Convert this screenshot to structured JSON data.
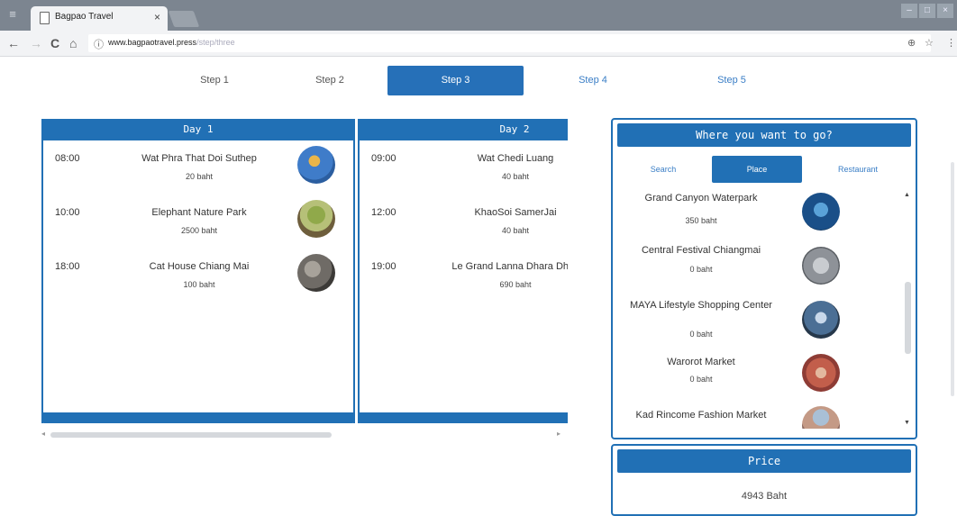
{
  "browser": {
    "tab_title": "Bagpao Travel",
    "tab_close": "×",
    "url_domain": "www.bagpaotravel.press",
    "url_path": "/step/three",
    "info_icon": "info-icon",
    "nav_back": "←",
    "nav_forward": "→",
    "nav_reload": "C",
    "nav_home": "⌂",
    "zoom_icon": "⊕",
    "star_icon": "☆",
    "menu_icon": "⋮"
  },
  "steps": [
    {
      "label": "Step 1"
    },
    {
      "label": "Step 2"
    },
    {
      "label": "Step 3"
    },
    {
      "label": "Step 4"
    },
    {
      "label": "Step 5"
    }
  ],
  "days": [
    {
      "title": "Day 1",
      "entries": [
        {
          "time": "08:00",
          "name": "Wat Phra That Doi Suthep",
          "price": "20 baht"
        },
        {
          "time": "10:00",
          "name": "Elephant Nature Park",
          "price": "2500 baht"
        },
        {
          "time": "18:00",
          "name": "Cat House Chiang Mai",
          "price": "100 baht"
        }
      ]
    },
    {
      "title": "Day 2",
      "entries": [
        {
          "time": "09:00",
          "name": "Wat Chedi Luang",
          "price": "40 baht"
        },
        {
          "time": "12:00",
          "name": "KhaoSoi SamerJai",
          "price": "40 baht"
        },
        {
          "time": "19:00",
          "name": "Le Grand Lanna Dhara Dhev",
          "price": "690 baht"
        }
      ]
    }
  ],
  "where": {
    "title": "Where you want to go?",
    "tabs": [
      "Search",
      "Place",
      "Restaurant"
    ],
    "places": [
      {
        "name": "Grand Canyon Waterpark",
        "price": "350 baht"
      },
      {
        "name": "Central Festival Chiangmai",
        "price": "0 baht"
      },
      {
        "name": "MAYA Lifestyle Shopping Center",
        "price": "0 baht"
      },
      {
        "name": "Warorot Market",
        "price": "0 baht"
      },
      {
        "name": "Kad Rincome Fashion Market",
        "price": ""
      }
    ]
  },
  "price": {
    "title": "Price",
    "total": "4943 Baht"
  }
}
